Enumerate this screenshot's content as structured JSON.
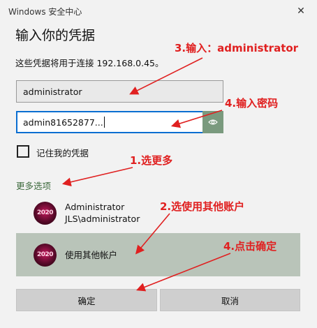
{
  "window": {
    "title": "Windows 安全中心",
    "close_glyph": "✕"
  },
  "dialog": {
    "heading": "输入你的凭据",
    "description": "这些凭据将用于连接 192.168.0.45。"
  },
  "fields": {
    "username_value": "administrator",
    "password_value": "admin81652877..."
  },
  "remember": {
    "label": "记住我的凭据",
    "checked": false
  },
  "more_options": {
    "label": "更多选项"
  },
  "accounts": [
    {
      "name": "Administrator",
      "detail": "JLS\\administrator",
      "avatar_text": "2020"
    },
    {
      "name": "使用其他帐户",
      "avatar_text": "2020"
    }
  ],
  "buttons": {
    "ok": "确定",
    "cancel": "取消"
  },
  "annotations": {
    "step_username": "3.输入：administrator",
    "step_password": "4.输入密码",
    "step_more": "1.选更多",
    "step_other": "2.选使用其他账户",
    "step_ok": "4.点击确定"
  },
  "colors": {
    "accent_focus": "#0a6ed1",
    "annotation": "#e02020",
    "link_green": "#3e6b3e"
  },
  "icons": {
    "reveal": "eye-icon",
    "close": "close-icon"
  }
}
